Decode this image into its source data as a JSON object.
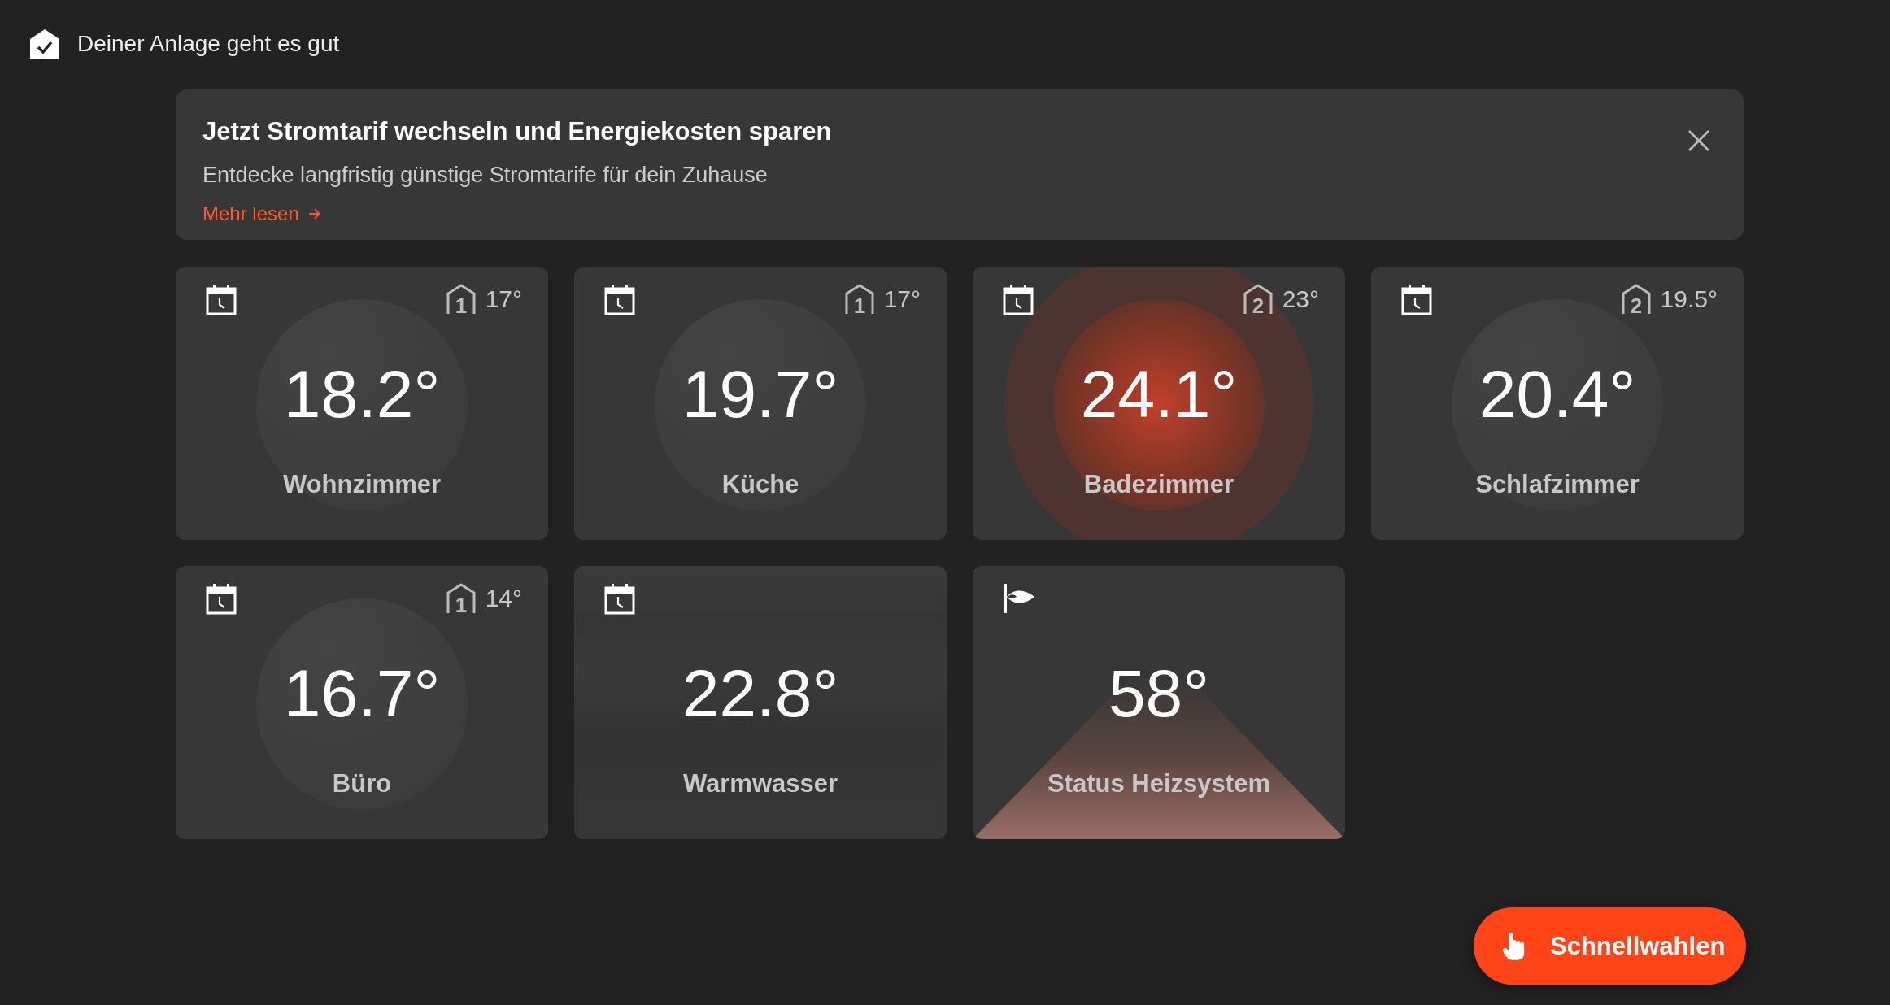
{
  "status": {
    "text": "Deiner Anlage geht es gut"
  },
  "banner": {
    "title": "Jetzt Stromtarif wechseln und Energiekosten sparen",
    "text": "Entdecke langfristig günstige Stromtarife für dein Zuhause",
    "link": "Mehr lesen"
  },
  "tiles": [
    {
      "kind": "room",
      "temperature": "18.2°",
      "name": "Wohnzimmer",
      "zone": "1",
      "setpoint": "17°",
      "heating": false
    },
    {
      "kind": "room",
      "temperature": "19.7°",
      "name": "Küche",
      "zone": "1",
      "setpoint": "17°",
      "heating": false
    },
    {
      "kind": "room",
      "temperature": "24.1°",
      "name": "Badezimmer",
      "zone": "2",
      "setpoint": "23°",
      "heating": true
    },
    {
      "kind": "room",
      "temperature": "20.4°",
      "name": "Schlafzimmer",
      "zone": "2",
      "setpoint": "19.5°",
      "heating": false
    },
    {
      "kind": "room",
      "temperature": "16.7°",
      "name": "Büro",
      "zone": "1",
      "setpoint": "14°",
      "heating": false
    },
    {
      "kind": "water",
      "temperature": "22.8°",
      "name": "Warmwasser"
    },
    {
      "kind": "system",
      "temperature": "58°",
      "name": "Status Heizsystem"
    }
  ],
  "fab": {
    "label": "Schnellwahlen"
  }
}
